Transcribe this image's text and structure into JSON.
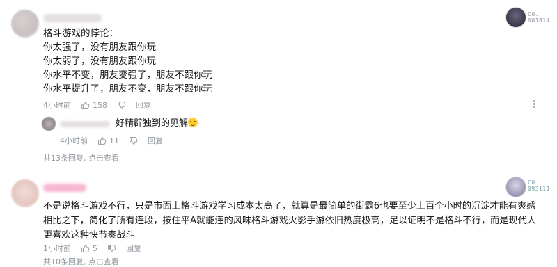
{
  "comments": [
    {
      "user": {
        "name": ""
      },
      "badge": {
        "line1": "C0.",
        "line2": "001814"
      },
      "content_lines": [
        "格斗游戏的悖论：",
        "你太强了，没有朋友跟你玩",
        "你太弱了，没有朋友跟你玩",
        "你水平不变，朋友变强了，朋友不跟你玩",
        "你水平提升了，朋友不变，朋友不跟你玩"
      ],
      "time": "4小时前",
      "likes": "158",
      "reply_label": "回复",
      "reply": {
        "user": {
          "name": ""
        },
        "text": "好精辟独到的见解",
        "emoji": "laughing-emoji",
        "time": "4小时前",
        "likes": "11",
        "reply_label": "回复"
      },
      "sub_summary": {
        "count_text": "共13条回复",
        "link_text": "点击查看"
      }
    },
    {
      "user": {
        "name": ""
      },
      "badge": {
        "line1": "C0.",
        "line2": "093111"
      },
      "content": "不是说格斗游戏不行，只是市面上格斗游戏学习成本太高了，就算是最简单的街霸6也要至少上百个小时的沉淀才能有爽感相比之下，简化了所有连段，按住平A就能连的风味格斗游戏火影手游依旧热度极高，足以证明不是格斗不行，而是现代人更喜欢这种快节奏战斗",
      "time": "1小时前",
      "likes": "5",
      "reply_label": "回复",
      "sub_summary": {
        "count_text": "共10条回复",
        "link_text": "点击查看"
      }
    }
  ],
  "colors": {
    "text": "#18191c",
    "meta": "#9499a0",
    "divider": "#e3e5e7",
    "pink_name": "#f7b7cf"
  }
}
